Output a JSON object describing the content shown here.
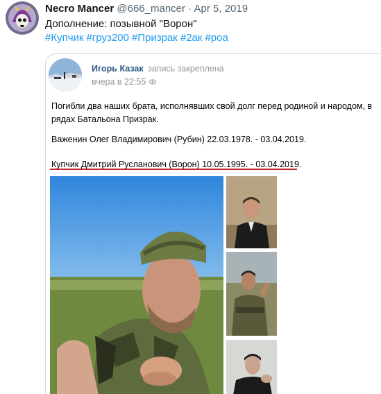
{
  "tweet": {
    "name": "Necro Mancer",
    "handle": "@666_mancer",
    "separator": "·",
    "date": "Apr 5, 2019",
    "text": "Дополнение: позывной \"Ворон\"",
    "hashtags": [
      "#Купчик",
      "#груз200",
      "#Призрак",
      "#2ак",
      "#роа"
    ]
  },
  "vk_post": {
    "author": "Игорь Казак",
    "status": "запись закреплена",
    "time": "вчера в 22:55",
    "paragraph1": "Погибли два наших брата, исполнявших свой долг перед родиной и народом, в рядах Батальона Призрак.",
    "paragraph2": "Важенин Олег Владимирович (Рубин) 22.03.1978. - 03.04.2019.",
    "paragraph3": "Купчик Дмитрий Русланович (Ворон) 10.05.1995. - 03.04.2019."
  },
  "colors": {
    "hashtag": "#1d9bf0",
    "vk_link": "#2a5885",
    "underline": "#c0282e",
    "muted": "#536471"
  },
  "icons": [
    "skull-avatar-icon",
    "eye-icon"
  ]
}
